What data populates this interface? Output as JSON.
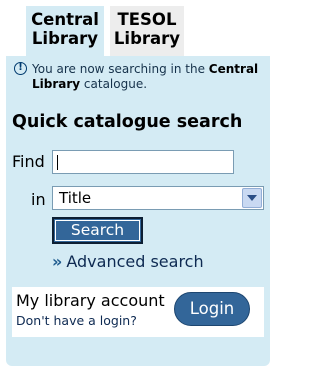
{
  "tabs": [
    {
      "line1": "Central",
      "line2": "Library"
    },
    {
      "line1": "TESOL",
      "line2": "Library"
    }
  ],
  "notice": {
    "icon": "info-icon",
    "text_before": "You are now searching in the ",
    "library": "Central Library",
    "text_after": " catalogue."
  },
  "search": {
    "heading": "Quick catalogue search",
    "find_label": "Find",
    "find_value": "",
    "in_label": "in",
    "scope_selected": "Title",
    "button_label": "Search",
    "advanced_link": "Advanced search",
    "advanced_icon": "double-chevron-right-icon"
  },
  "account": {
    "title": "My library account",
    "login_help_link": "Don't have a login?",
    "login_button": "Login"
  }
}
